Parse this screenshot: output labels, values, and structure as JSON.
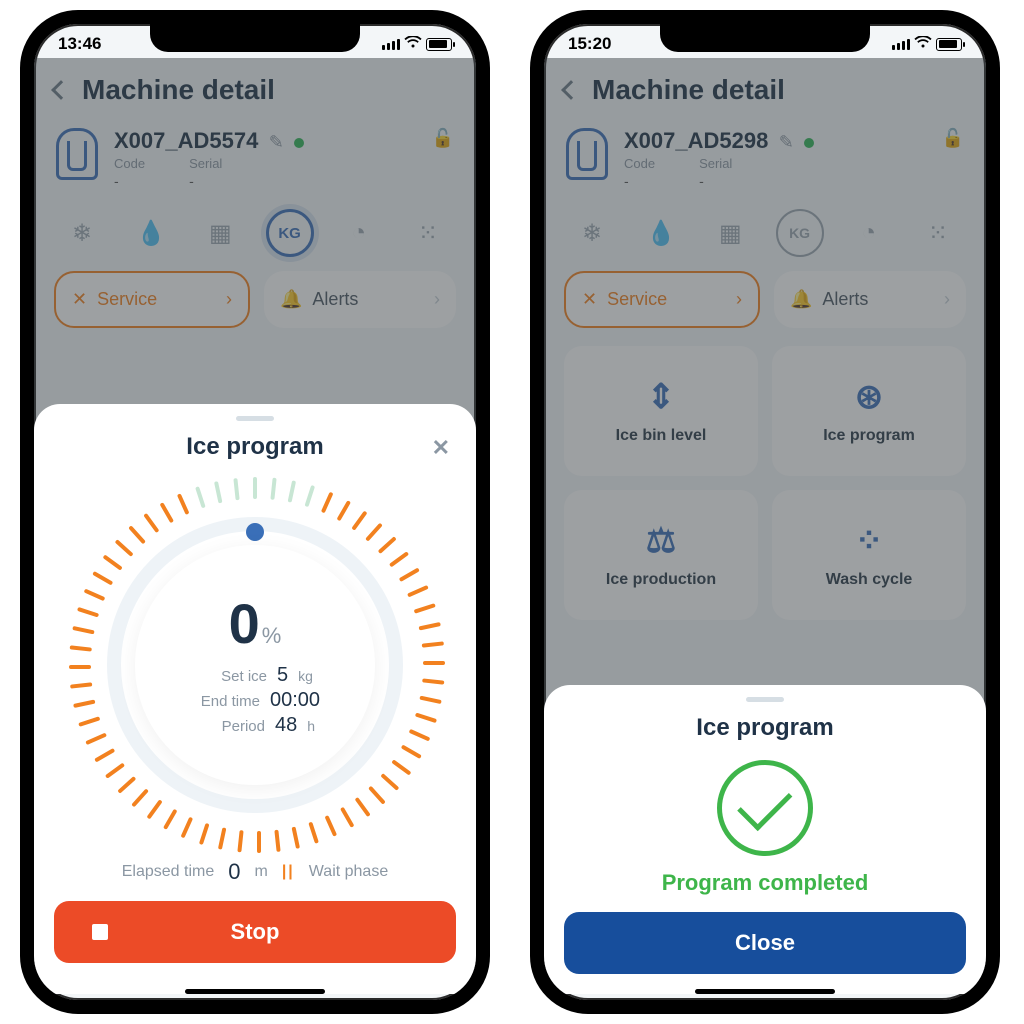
{
  "phone1": {
    "time": "13:46",
    "page_title": "Machine detail",
    "machine_name": "X007_AD5574",
    "code_label": "Code",
    "code_val": "-",
    "serial_label": "Serial",
    "serial_val": "-",
    "service_label": "Service",
    "alerts_label": "Alerts",
    "sheet_title": "Ice program",
    "percent_value": "0",
    "percent_unit": "%",
    "set_ice_label": "Set ice",
    "set_ice_val": "5",
    "set_ice_unit": "kg",
    "end_time_label": "End time",
    "end_time_val": "00:00",
    "period_label": "Period",
    "period_val": "48",
    "period_unit": "h",
    "elapsed_label": "Elapsed time",
    "elapsed_val": "0",
    "elapsed_unit": "m",
    "phase_label": "Wait phase",
    "stop_label": "Stop"
  },
  "phone2": {
    "time": "15:20",
    "page_title": "Machine detail",
    "machine_name": "X007_AD5298",
    "code_label": "Code",
    "code_val": "-",
    "serial_label": "Serial",
    "serial_val": "-",
    "service_label": "Service",
    "alerts_label": "Alerts",
    "card1": "Ice bin level",
    "card2": "Ice program",
    "card3": "Ice production",
    "card4": "Wash cycle",
    "sheet_title": "Ice program",
    "completed_text": "Program completed",
    "close_label": "Close"
  }
}
